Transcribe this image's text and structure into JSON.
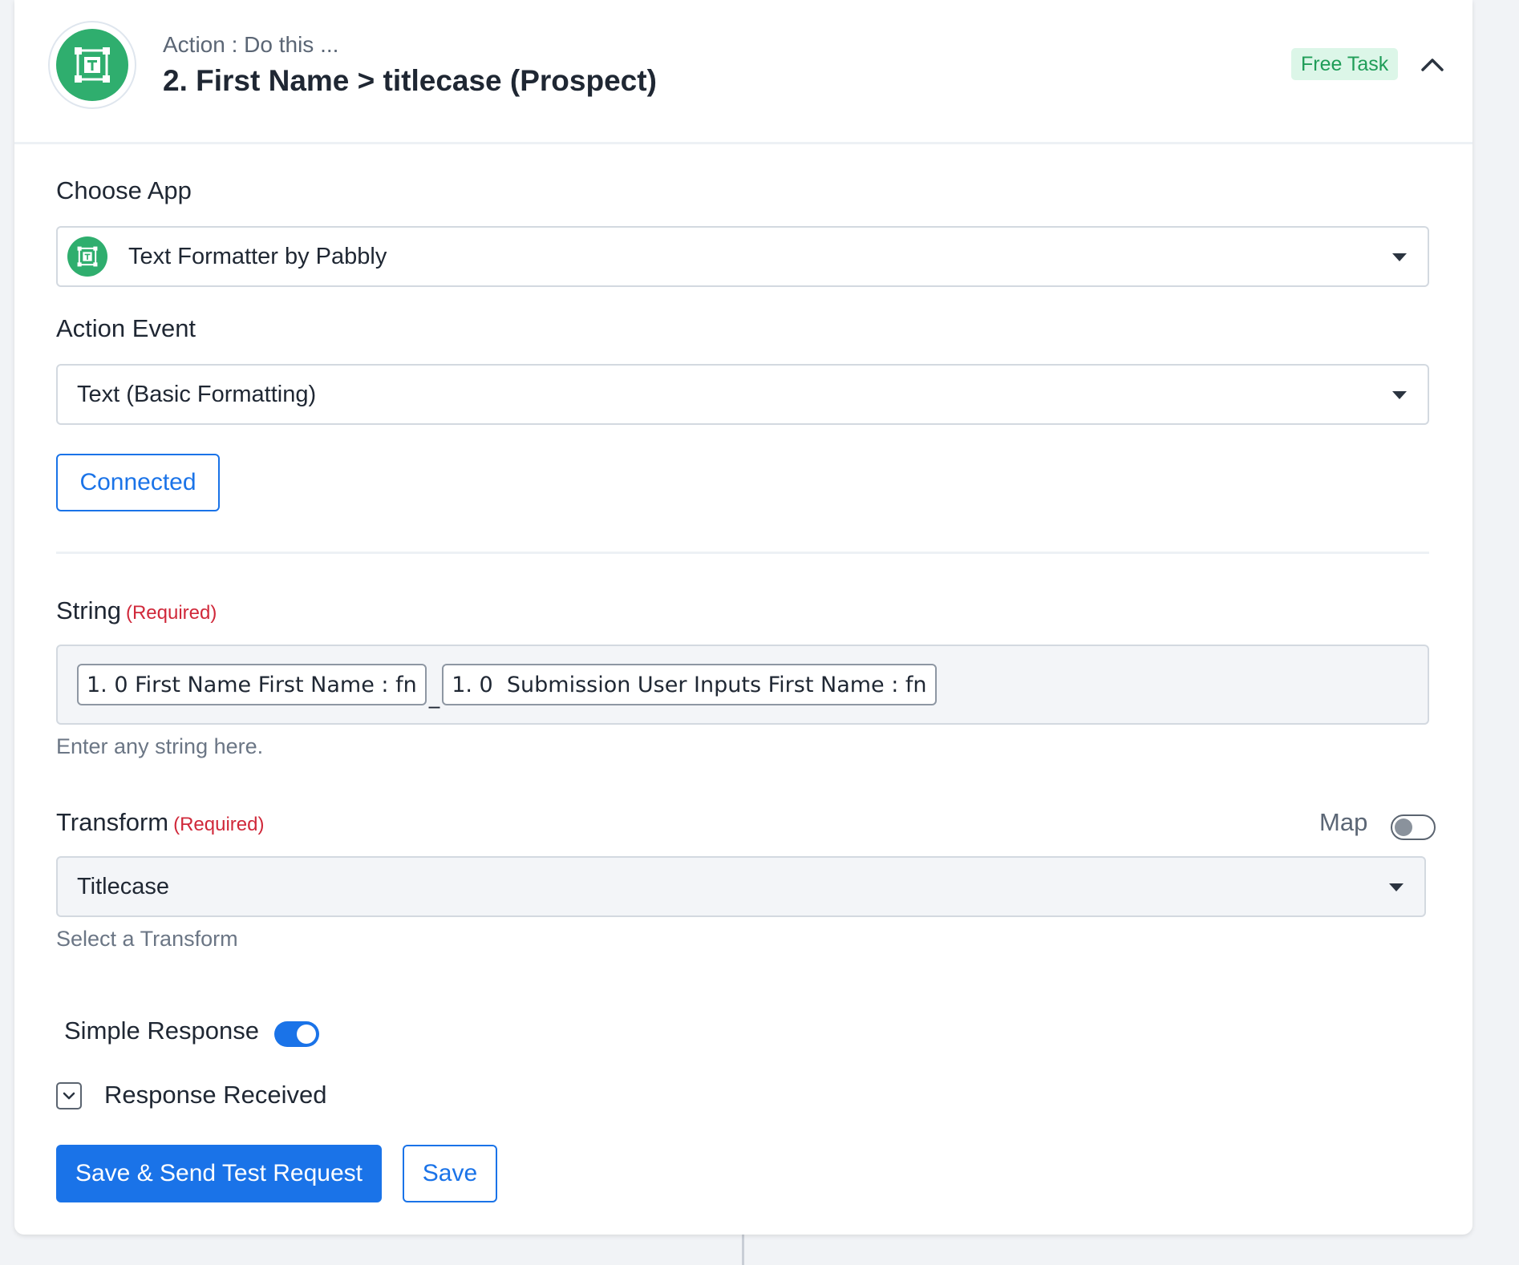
{
  "header": {
    "subtitle": "Action : Do this ...",
    "title": "2. First Name > titlecase (Prospect)",
    "badge": "Free Task",
    "app_icon": "text-formatter-icon",
    "collapse_icon": "chevron-up-icon"
  },
  "choose_app": {
    "label": "Choose App",
    "value": "Text Formatter by Pabbly"
  },
  "action_event": {
    "label": "Action Event",
    "value": "Text (Basic Formatting)"
  },
  "connected_button": "Connected",
  "string_field": {
    "label": "String",
    "required": "(Required)",
    "tokens": [
      "1. 0 First Name First Name : fn",
      "1. 0  Submission User Inputs First Name : fn"
    ],
    "separator": "_",
    "help": "Enter any string here."
  },
  "transform_field": {
    "label": "Transform",
    "required": "(Required)",
    "map_label": "Map",
    "map_enabled": false,
    "value": "Titlecase",
    "help": "Select a Transform"
  },
  "simple_response": {
    "label": "Simple Response",
    "enabled": true
  },
  "response_received": {
    "label": "Response Received"
  },
  "buttons": {
    "save_and_test": "Save & Send Test Request",
    "save": "Save"
  },
  "colors": {
    "primary": "#1a73e8",
    "brand_green": "#2fae6e",
    "required_red": "#d0283a",
    "badge_bg": "#dcf6e8"
  }
}
